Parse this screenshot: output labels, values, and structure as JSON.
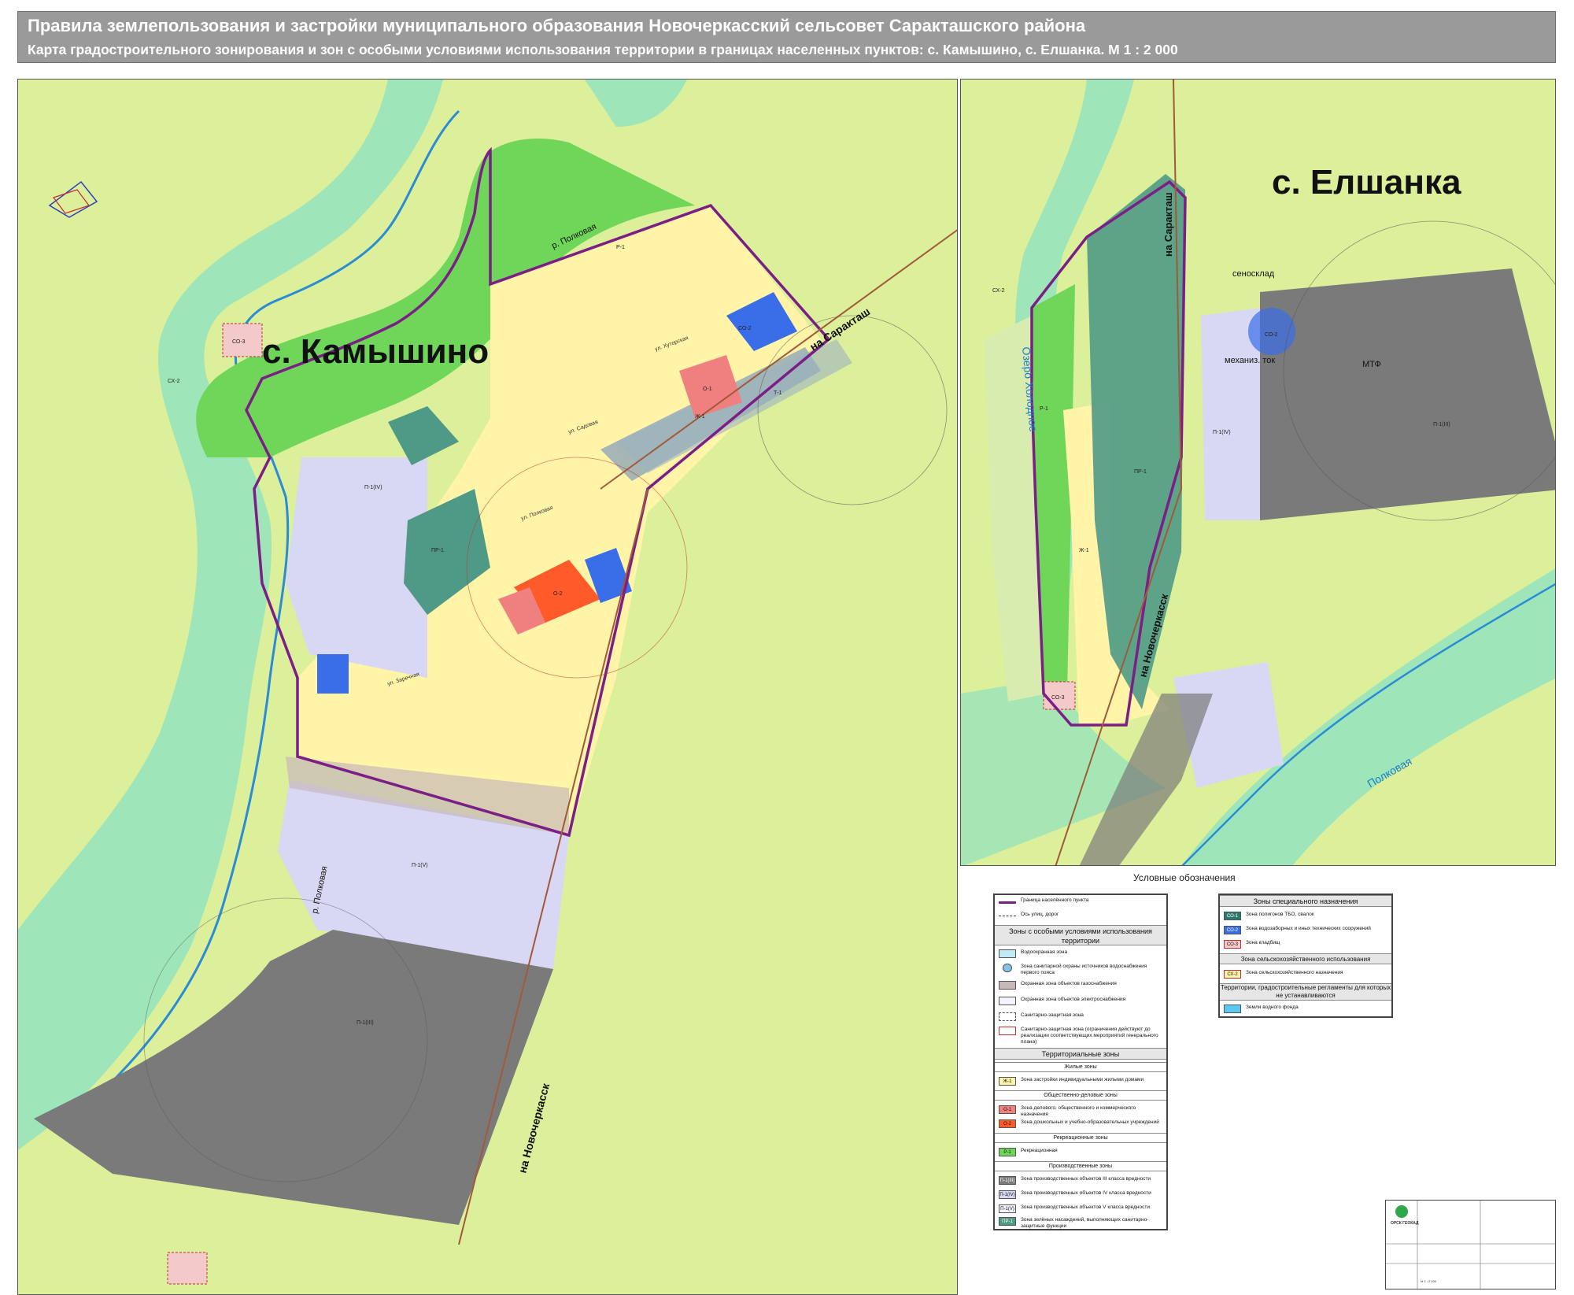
{
  "header": {
    "title": "Правила землепользования и застройки муниципального образования Новочеркасский сельсовет Саракташского района",
    "subtitle": "Карта градостроительного зонирования и зон с особыми условиями использования территории в границах населенных пунктов: с. Камышино, с. Елшанка. М 1 : 2 000"
  },
  "map_left": {
    "settlement": "с. Камышино",
    "roads": {
      "to_saraktash": "на Саракташ",
      "to_novocherkassk": "на Новочеркасск"
    },
    "river": "р. Полковая",
    "streets": [
      "ул. Хуторская",
      "ул. Полковая",
      "ул. Садовая",
      "ул. Заречная"
    ],
    "zone_labels": [
      "СХ-2",
      "Р-1",
      "Ж-1",
      "О-1",
      "О-2",
      "П-1(IV)",
      "П-1(V)",
      "П-1(III)",
      "ПР-1",
      "СО-2",
      "СО-3",
      "Т-1"
    ]
  },
  "map_right": {
    "settlement": "с. Елшанка",
    "roads": {
      "to_saraktash": "на Саракташ",
      "to_novocherkassk": "на Новочеркасск"
    },
    "lake": "Озеро Холодное",
    "river": "Полковая",
    "places": {
      "hay": "сеносклад",
      "tok": "механиз. ток",
      "farm": "МТФ"
    },
    "zone_labels": [
      "СХ-2",
      "Р-1",
      "Ж-1",
      "П-1(IV)",
      "П-1(III)",
      "ПР-1",
      "СО-2",
      "СО-3"
    ]
  },
  "legend": {
    "title": "Условные обозначения",
    "left_box": {
      "rows_top": [
        {
          "key": "",
          "label": "Граница населённого пункта"
        },
        {
          "key": "",
          "label": "Ось улиц, дорог"
        }
      ],
      "sec_special": "Зоны с особыми условиями использования территории",
      "rows_special": [
        {
          "key": "",
          "label": "Водоохранная зона"
        },
        {
          "key": "",
          "label": "Зона санитарной охраны источников водоснабжения первого пояса"
        },
        {
          "key": "",
          "label": "Охранная зона объектов газоснабжения"
        },
        {
          "key": "",
          "label": "Охранная зона объектов электроснабжения"
        },
        {
          "key": "",
          "label": "Санитарно-защитная зона"
        },
        {
          "key": "",
          "label": "Санитарно-защитная зона (ограничения действуют до реализации соответствующих мероприятий генерального плана)"
        }
      ],
      "sec_territorial": "Территориальные зоны",
      "sec_residential": "Жилые зоны",
      "rows_residential": [
        {
          "key": "Ж-1",
          "label": "Зона застройки индивидуальными жилыми домами"
        }
      ],
      "sec_public": "Общественно-деловые зоны",
      "rows_public": [
        {
          "key": "О-1",
          "label": "Зона делового, общественного и коммерческого назначения"
        },
        {
          "key": "О-2",
          "label": "Зона дошкольных и учебно-образовательных учреждений"
        }
      ],
      "sec_recreation": "Рекреационные зоны",
      "rows_recreation": [
        {
          "key": "Р-1",
          "label": "Рекреационная"
        }
      ],
      "sec_production": "Производственные зоны",
      "rows_production": [
        {
          "key": "П-1(III)",
          "label": "Зона производственных объектов III класса вредности"
        },
        {
          "key": "П-1(IV)",
          "label": "Зона производственных объектов IV класса вредности"
        },
        {
          "key": "П-1(V)",
          "label": "Зона производственных объектов V класса вредности"
        },
        {
          "key": "ПР-1",
          "label": "Зона зелёных насаждений, выполняющих санитарно-защитные функции"
        }
      ]
    },
    "right_box": {
      "sec_special_purpose": "Зоны специального назначения",
      "rows_special_purpose": [
        {
          "key": "СО-1",
          "label": "Зона полигонов ТБО, свалок"
        },
        {
          "key": "СО-2",
          "label": "Зона водозаборных и иных технических сооружений"
        },
        {
          "key": "СО-3",
          "label": "Зона кладбищ"
        }
      ],
      "sec_agri": "Зона сельскохозяйственного использования",
      "rows_agri": [
        {
          "key": "СХ-2",
          "label": "Зона сельскохозяйственного назначения"
        }
      ],
      "sec_noreg": "Территории, градостроительные регламенты для которых не устанавливаются",
      "rows_noreg": [
        {
          "key": "",
          "label": "Земли водного фонда"
        }
      ]
    }
  },
  "stamp": {
    "org": "ОРСК ГЕОКАД",
    "scale": "М 1 : 2 000"
  },
  "colors": {
    "agri": "#dcef9a",
    "residential": "#fff4a8",
    "recreation": "#6fd65a",
    "production": "#7a7a7a",
    "production_light": "#d8d8f4",
    "green_buffer": "#4f9a86",
    "water_zone": "#7fe0b8",
    "water": "#8fd8f4",
    "boundary": "#7b1f86",
    "public1": "#f08080",
    "public2": "#ff5a2a",
    "tech": "#3a6de8"
  }
}
